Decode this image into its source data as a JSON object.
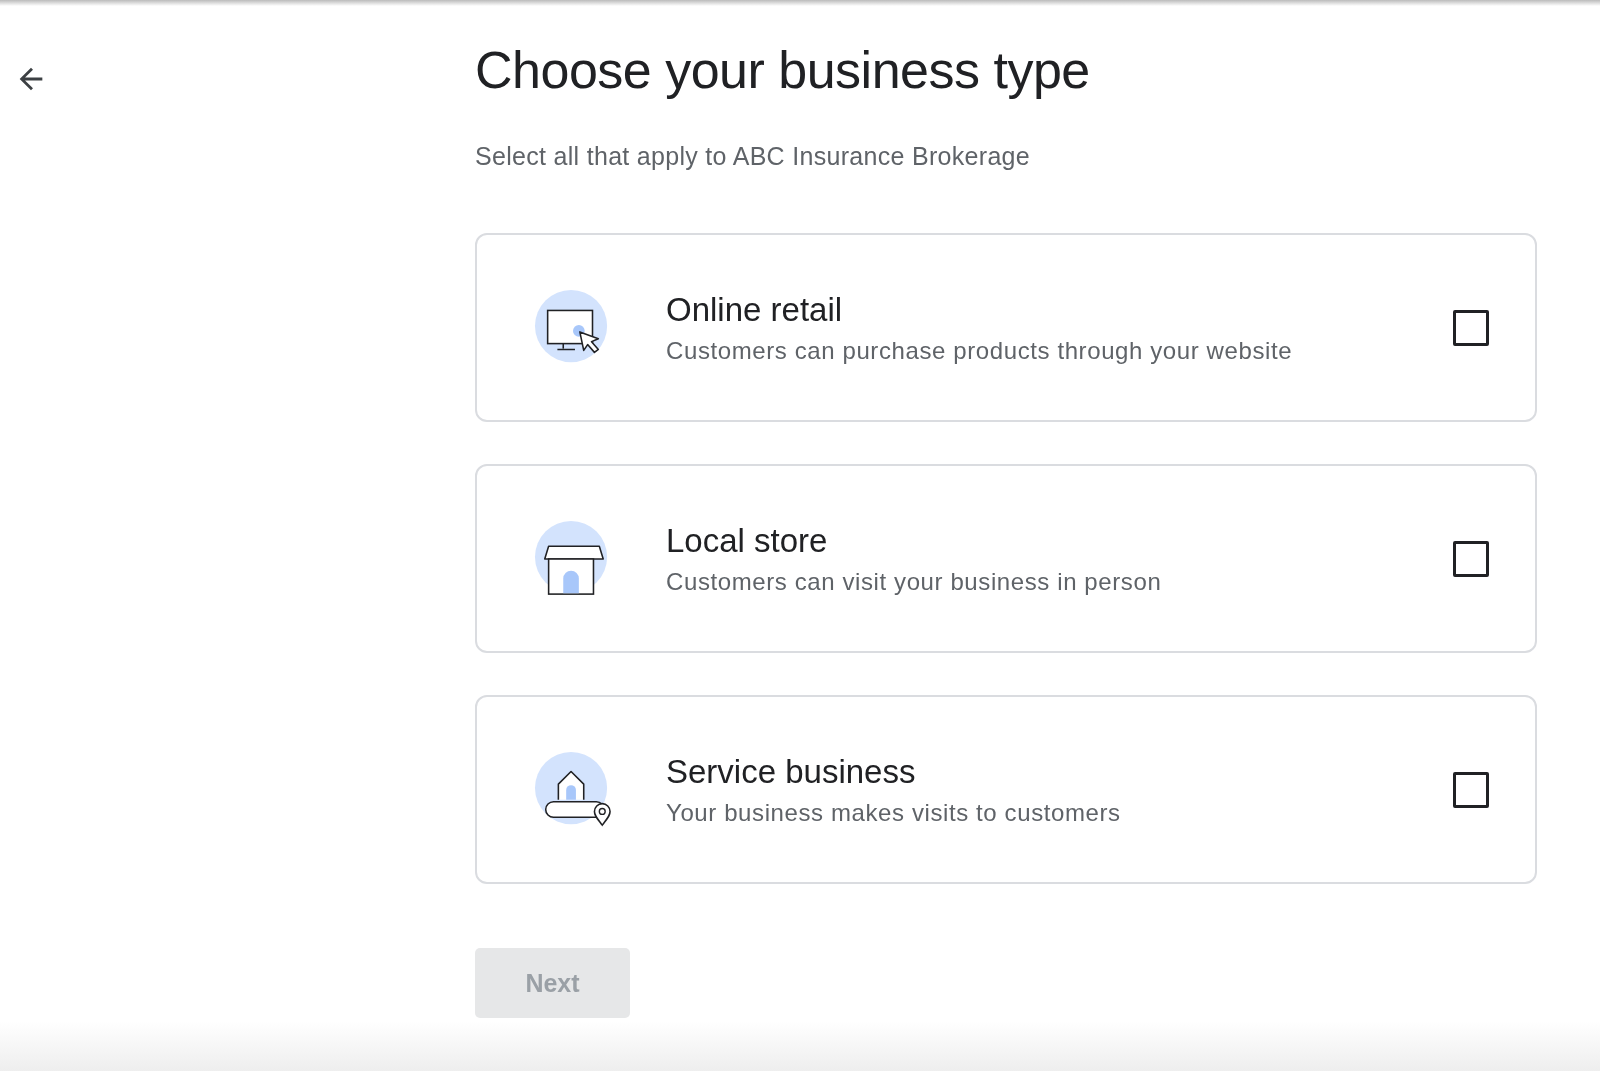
{
  "title": "Choose your business type",
  "subtitle": "Select all that apply to ABC Insurance Brokerage",
  "options": [
    {
      "kind": "online",
      "title": "Online retail",
      "description": "Customers can purchase products through your website",
      "checked": false
    },
    {
      "kind": "store",
      "title": "Local store",
      "description": "Customers can visit your business in person",
      "checked": false
    },
    {
      "kind": "service",
      "title": "Service business",
      "description": "Your business makes visits to customers",
      "checked": false
    }
  ],
  "next_button": {
    "label": "Next",
    "disabled": true
  }
}
